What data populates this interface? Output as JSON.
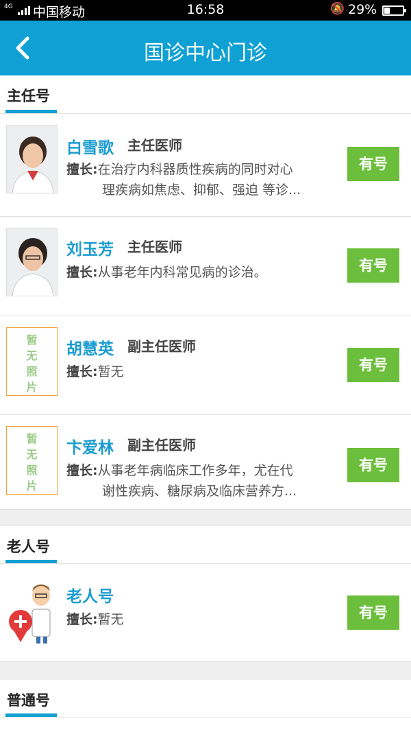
{
  "status_bar": {
    "network": "4G",
    "carrier": "中国移动",
    "time": "16:58",
    "battery": "29%",
    "battery_level": 0.29
  },
  "header": {
    "title": "国诊中心门诊"
  },
  "sections": [
    {
      "title": "主任号",
      "doctors": [
        {
          "name": "白雪歌",
          "title": "主任医师",
          "skill_label": "擅长:",
          "skill_line1": "在治疗内科器质性疾病的同时对心",
          "skill_line2": "理疾病如焦虑、抑郁、强迫 等诊...",
          "button": "有号"
        },
        {
          "name": "刘玉芳",
          "title": "主任医师",
          "skill_label": "擅长:",
          "skill_line1": "从事老年内科常见病的诊治。",
          "button": "有号"
        },
        {
          "name": "胡慧英",
          "title": "副主任医师",
          "skill_label": "擅长:",
          "skill_line1": "暂无",
          "button": "有号",
          "no_photo": "暂无照片"
        },
        {
          "name": "卞爱林",
          "title": "副主任医师",
          "skill_label": "擅长:",
          "skill_line1": "从事老年病临床工作多年，尤在代",
          "skill_line2": "谢性疾病、糖尿病及临床营养方...",
          "button": "有号",
          "no_photo": "暂无照片"
        }
      ]
    },
    {
      "title": "老人号",
      "doctors": [
        {
          "name": "老人号",
          "skill_label": "擅长:",
          "skill_line1": "暂无",
          "button": "有号"
        }
      ]
    },
    {
      "title": "普通号"
    }
  ],
  "colors": {
    "primary": "#0fa0d4",
    "button": "#6cbf3c",
    "name": "#1a9cd0",
    "no_photo_border": "#f0a33a"
  }
}
